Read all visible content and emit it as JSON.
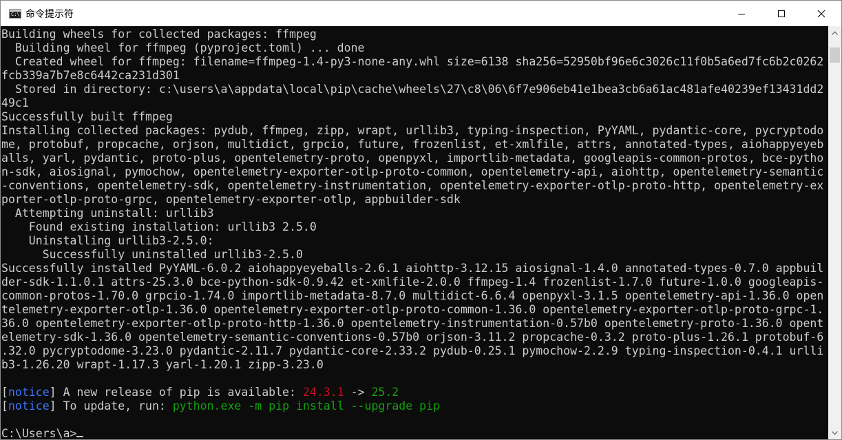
{
  "window": {
    "title": "命令提示符",
    "icon_label": "C:\\",
    "controls": [
      "minimize-icon",
      "maximize-icon",
      "close-icon"
    ]
  },
  "console": {
    "lines": [
      [
        {
          "t": "Building wheels for collected packages: ffmpeg"
        }
      ],
      [
        {
          "t": "  Building wheel for ffmpeg (pyproject.toml) ... done"
        }
      ],
      [
        {
          "t": "  Created wheel for ffmpeg: filename=ffmpeg-1.4-py3-none-any.whl size=6138 sha256=52950bf96e6c3026c11f0b5a6ed7fc6b2c0262"
        }
      ],
      [
        {
          "t": "fcb339a7b7e8c6442ca231d301"
        }
      ],
      [
        {
          "t": "  Stored in directory: c:\\users\\a\\appdata\\local\\pip\\cache\\wheels\\27\\c8\\06\\6f7e906eb41e1bea3cb6a61ac481afe40239ef13431dd2"
        }
      ],
      [
        {
          "t": "49c1"
        }
      ],
      [
        {
          "t": "Successfully built ffmpeg"
        }
      ],
      [
        {
          "t": "Installing collected packages: pydub, ffmpeg, zipp, wrapt, urllib3, typing-inspection, PyYAML, pydantic-core, pycryptodo"
        }
      ],
      [
        {
          "t": "me, protobuf, propcache, orjson, multidict, grpcio, future, frozenlist, et-xmlfile, attrs, annotated-types, aiohappyeyeb"
        }
      ],
      [
        {
          "t": "alls, yarl, pydantic, proto-plus, opentelemetry-proto, openpyxl, importlib-metadata, googleapis-common-protos, bce-pytho"
        }
      ],
      [
        {
          "t": "n-sdk, aiosignal, pymochow, opentelemetry-exporter-otlp-proto-common, opentelemetry-api, aiohttp, opentelemetry-semantic"
        }
      ],
      [
        {
          "t": "-conventions, opentelemetry-sdk, opentelemetry-instrumentation, opentelemetry-exporter-otlp-proto-http, opentelemetry-ex"
        }
      ],
      [
        {
          "t": "porter-otlp-proto-grpc, opentelemetry-exporter-otlp, appbuilder-sdk"
        }
      ],
      [
        {
          "t": "  Attempting uninstall: urllib3"
        }
      ],
      [
        {
          "t": "    Found existing installation: urllib3 2.5.0"
        }
      ],
      [
        {
          "t": "    Uninstalling urllib3-2.5.0:"
        }
      ],
      [
        {
          "t": "      Successfully uninstalled urllib3-2.5.0"
        }
      ],
      [
        {
          "t": "Successfully installed PyYAML-6.0.2 aiohappyeyeballs-2.6.1 aiohttp-3.12.15 aiosignal-1.4.0 annotated-types-0.7.0 appbuil"
        }
      ],
      [
        {
          "t": "der-sdk-1.1.0.1 attrs-25.3.0 bce-python-sdk-0.9.42 et-xmlfile-2.0.0 ffmpeg-1.4 frozenlist-1.7.0 future-1.0.0 googleapis-"
        }
      ],
      [
        {
          "t": "common-protos-1.70.0 grpcio-1.74.0 importlib-metadata-8.7.0 multidict-6.6.4 openpyxl-3.1.5 opentelemetry-api-1.36.0 open"
        }
      ],
      [
        {
          "t": "telemetry-exporter-otlp-1.36.0 opentelemetry-exporter-otlp-proto-common-1.36.0 opentelemetry-exporter-otlp-proto-grpc-1."
        }
      ],
      [
        {
          "t": "36.0 opentelemetry-exporter-otlp-proto-http-1.36.0 opentelemetry-instrumentation-0.57b0 opentelemetry-proto-1.36.0 opent"
        }
      ],
      [
        {
          "t": "elemetry-sdk-1.36.0 opentelemetry-semantic-conventions-0.57b0 orjson-3.11.2 propcache-0.3.2 proto-plus-1.26.1 protobuf-6"
        }
      ],
      [
        {
          "t": ".32.0 pycryptodome-3.23.0 pydantic-2.11.7 pydantic-core-2.33.2 pydub-0.25.1 pymochow-2.2.9 typing-inspection-0.4.1 urlli"
        }
      ],
      [
        {
          "t": "b3-1.26.20 wrapt-1.17.3 yarl-1.20.1 zipp-3.23.0"
        }
      ],
      [
        {
          "t": ""
        }
      ],
      [
        {
          "t": "["
        },
        {
          "t": "notice",
          "c": "notice"
        },
        {
          "t": "] A new release of pip is available: "
        },
        {
          "t": "24.3.1",
          "c": "red"
        },
        {
          "t": " -> "
        },
        {
          "t": "25.2",
          "c": "green"
        }
      ],
      [
        {
          "t": "["
        },
        {
          "t": "notice",
          "c": "notice"
        },
        {
          "t": "] To update, run: "
        },
        {
          "t": "python.exe -m pip install --upgrade pip",
          "c": "green"
        }
      ],
      [
        {
          "t": ""
        }
      ],
      [
        {
          "t": "C:\\Users\\a>"
        },
        {
          "cursor": true
        }
      ]
    ]
  },
  "colors": {
    "background": "#0c0c0c",
    "text": "#cccccc",
    "notice": "#3b78ff",
    "red": "#c50f1f",
    "green": "#13a10e"
  }
}
